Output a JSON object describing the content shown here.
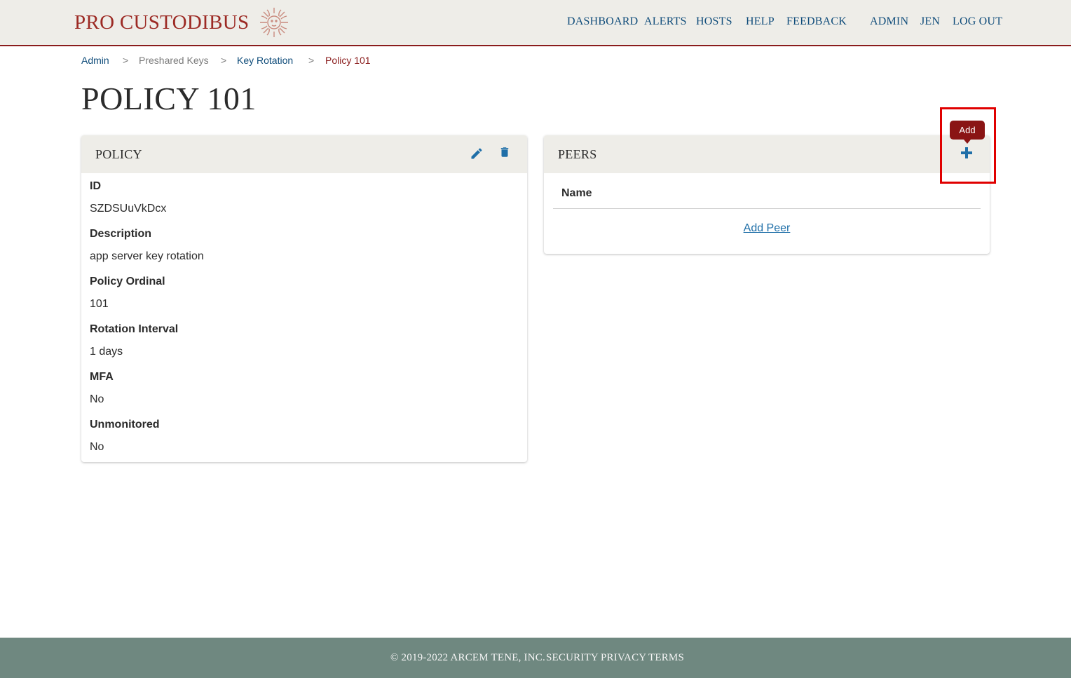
{
  "brand": {
    "name": "PRO CUSTODIBUS"
  },
  "nav": {
    "items": [
      "DASHBOARD",
      "ALERTS",
      "HOSTS",
      "HELP",
      "FEEDBACK"
    ],
    "user_items": [
      "ADMIN",
      "JEN",
      "LOG OUT"
    ]
  },
  "breadcrumb": {
    "items": [
      "Admin",
      "Preshared Keys",
      "Key Rotation",
      "Policy 101"
    ],
    "separator": ">"
  },
  "page_title": "POLICY 101",
  "policy_card": {
    "title": "POLICY",
    "fields": [
      {
        "label": "ID",
        "value": "SZDSUuVkDcx"
      },
      {
        "label": "Description",
        "value": "app server key rotation"
      },
      {
        "label": "Policy Ordinal",
        "value": "101"
      },
      {
        "label": "Rotation Interval",
        "value": "1 days"
      },
      {
        "label": "MFA",
        "value": "No"
      },
      {
        "label": "Unmonitored",
        "value": "No"
      }
    ],
    "icons": {
      "edit": "pencil-icon",
      "delete": "trash-icon"
    }
  },
  "peers_card": {
    "title": "PEERS",
    "column_header": "Name",
    "add_peer_link": "Add Peer",
    "add_button_icon": "plus-icon",
    "tooltip": "Add"
  },
  "footer": {
    "copyright": "© 2019-2022 ARCEM TENE, INC.",
    "links": [
      "SECURITY",
      "PRIVACY",
      "TERMS"
    ]
  },
  "colors": {
    "brand_red": "#9c2a24",
    "nav_blue": "#0f4c7a",
    "link_blue": "#1f6fa8",
    "header_bg": "#eeede8",
    "footer_bg": "#6f8880",
    "tooltip_bg": "#8a1414",
    "highlight": "#e00000"
  }
}
